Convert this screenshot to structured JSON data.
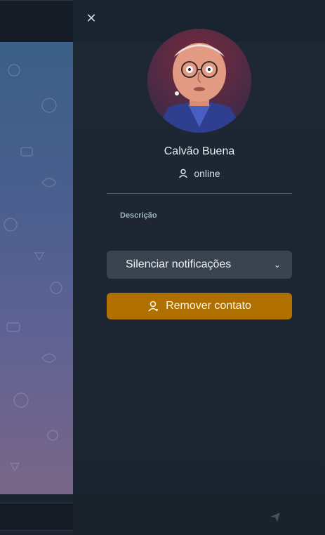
{
  "panel": {
    "close_glyph": "✕",
    "close_icon": "close-icon",
    "contact_name": "Calvão Buena",
    "status_icon": "user-icon",
    "status_text": "online",
    "description_label": "Descrição",
    "mute_select": {
      "value": "Silenciar notificações",
      "chevron_icon": "chevron-down-icon"
    },
    "remove_button": {
      "icon": "user-icon",
      "label": "Remover contato",
      "color": "#b07000"
    }
  },
  "colors": {
    "panel_bg": "#1b2430",
    "accent": "#b07000",
    "select_bg": "#3a4450"
  }
}
